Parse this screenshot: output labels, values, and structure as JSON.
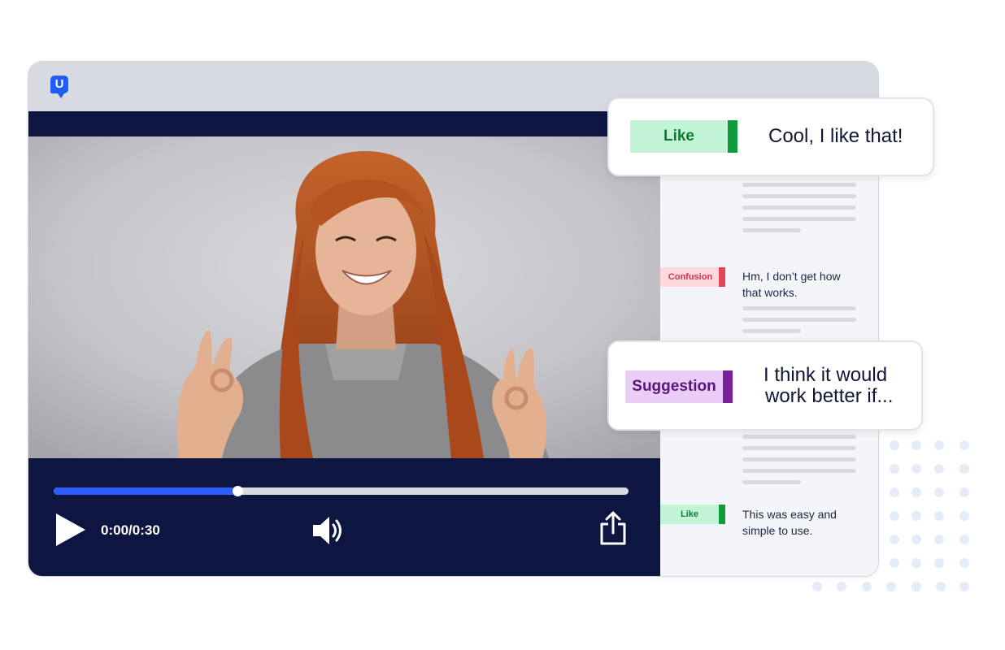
{
  "app": {
    "logo_letter": "U"
  },
  "player": {
    "time_display": "0:00/0:30",
    "progress": 0.32,
    "play_label": "Play",
    "volume_label": "Volume",
    "share_label": "Share"
  },
  "transcript": {
    "entries": [
      {
        "tag": "Confusion",
        "text_line1": "Hm, I don’t get how",
        "text_line2": "that works."
      },
      {
        "tag": "Like",
        "text_line1": "This was easy and",
        "text_line2": "simple to use."
      }
    ]
  },
  "cards": [
    {
      "tag": "Like",
      "text_line1": "Cool, I like that!"
    },
    {
      "tag": "Suggestion",
      "text_line1": "I think it would",
      "text_line2": "work better if..."
    }
  ],
  "colors": {
    "accent": "#2f5cff",
    "player_bg": "#0d1641",
    "like_tag_bg": "#c2f5d8",
    "like_tag_bar": "#119b3a",
    "like_text": "#0f7a33",
    "confusion_tag_bg": "#fbd9dd",
    "confusion_tag_bar": "#e3455c",
    "confusion_text": "#d2344a",
    "suggestion_tag_bg": "#e9cdf6",
    "suggestion_tag_bar": "#7a1f9a",
    "suggestion_text": "#5b1478"
  }
}
